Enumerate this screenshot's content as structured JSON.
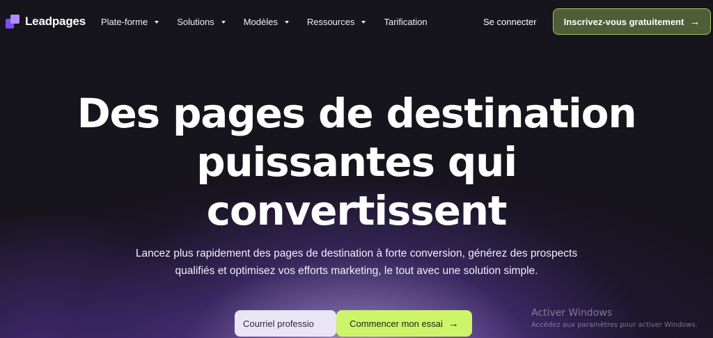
{
  "brand": {
    "name": "Leadpages",
    "logo_icon": "leadpages-logo-icon",
    "accent_purple": "#7b4df0",
    "accent_green": "#cdf56a"
  },
  "nav": {
    "items": [
      {
        "label": "Plate-forme",
        "has_dropdown": true
      },
      {
        "label": "Solutions",
        "has_dropdown": true
      },
      {
        "label": "Modèles",
        "has_dropdown": true
      },
      {
        "label": "Ressources",
        "has_dropdown": true
      },
      {
        "label": "Tarification",
        "has_dropdown": false
      }
    ],
    "login_label": "Se connecter",
    "signup_label": "Inscrivez-vous gratuitement",
    "signup_icon": "arrow-right-icon"
  },
  "hero": {
    "title_line1": "Des pages de destination",
    "title_line2": "puissantes qui",
    "title_line3": "convertissent",
    "subtitle": "Lancez plus rapidement des pages de destination à forte conversion, générez des prospects qualifiés et optimisez vos efforts marketing, le tout avec une solution simple.",
    "email_value": "Courriel professio",
    "cta_label": "Commencer mon essai",
    "cta_icon": "arrow-right-icon"
  },
  "watermark": {
    "title": "Activer Windows",
    "subtitle": "Accédez aux paramètres pour activer Windows."
  }
}
